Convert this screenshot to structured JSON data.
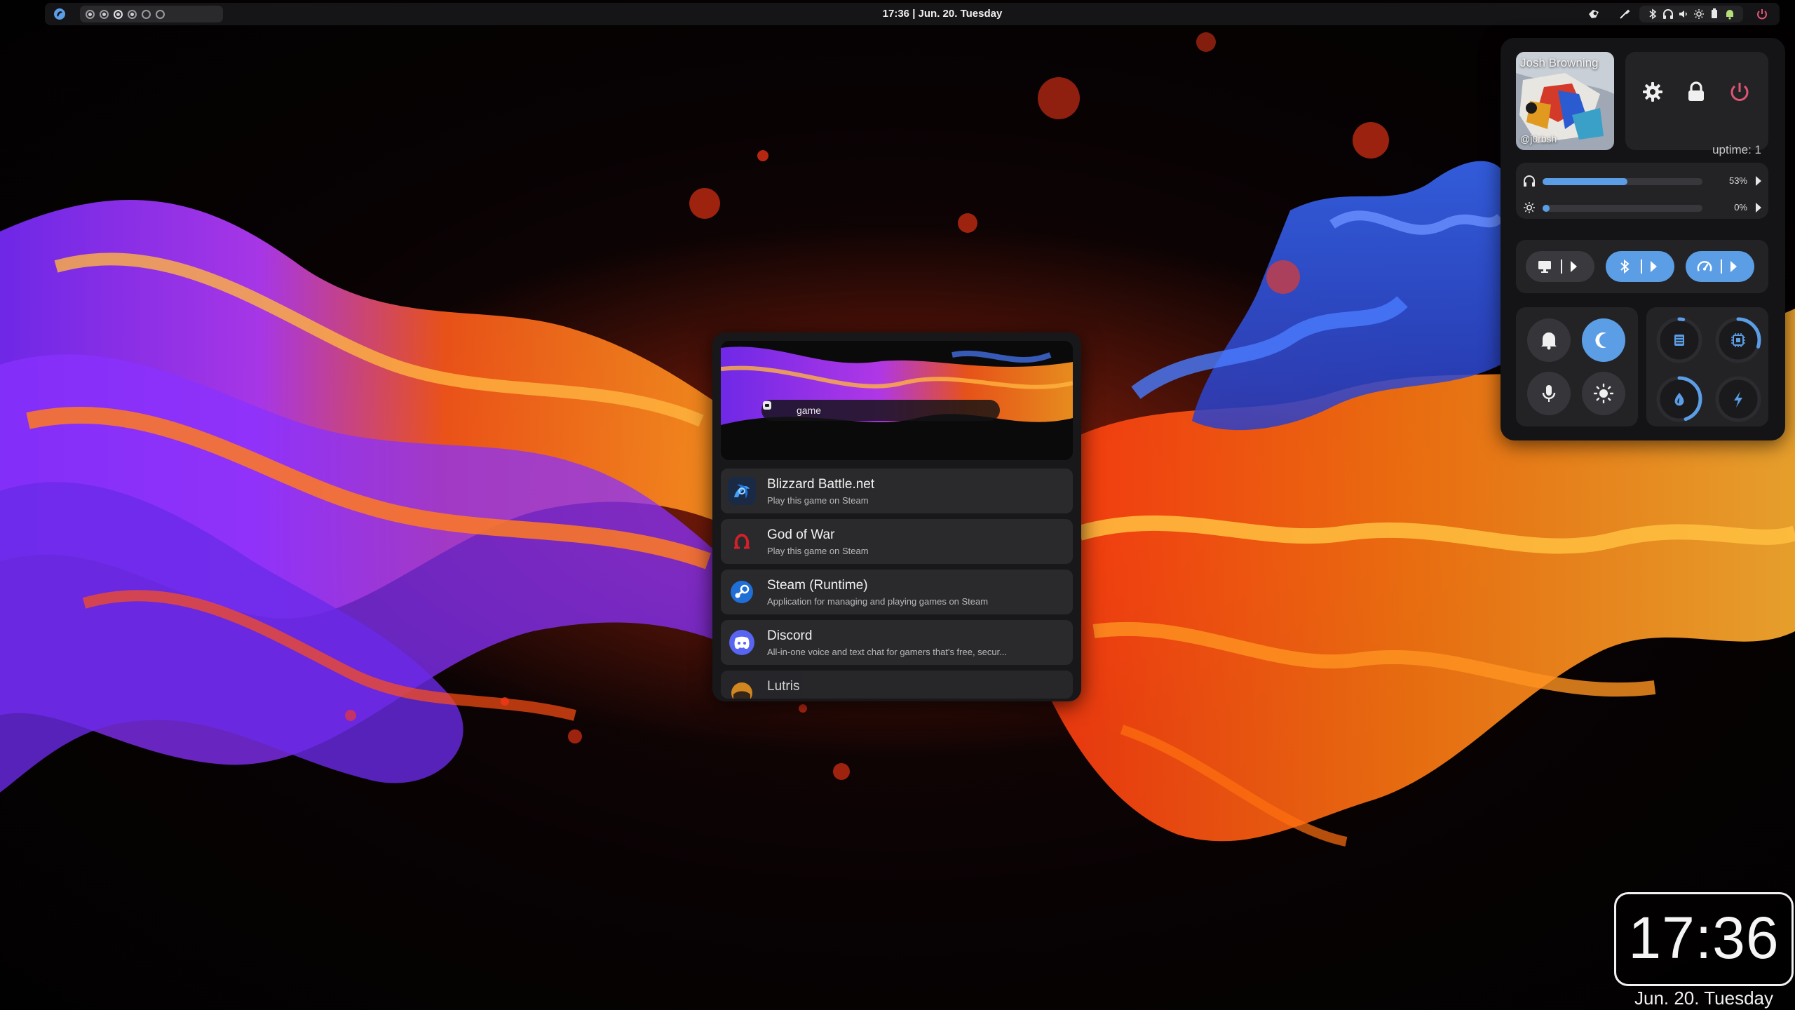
{
  "topbar": {
    "clock_text": "17:36  |  Jun. 20. Tuesday",
    "workspaces": [
      {
        "state": "filled"
      },
      {
        "state": "filled"
      },
      {
        "state": "active"
      },
      {
        "state": "filled"
      },
      {
        "state": "empty"
      },
      {
        "state": "empty"
      }
    ],
    "icons": [
      "logo-icon",
      "steam-tray-icon",
      "color-picker-icon",
      "bluetooth-icon",
      "headphones-icon",
      "volume-icon",
      "brightness-icon",
      "battery-icon",
      "notification-icon",
      "power-icon"
    ]
  },
  "launcher": {
    "search_query": "game",
    "results": [
      {
        "title": "Blizzard Battle.net",
        "description": "Play this game on Steam",
        "icon": "battlenet-icon"
      },
      {
        "title": "God of War",
        "description": "Play this game on Steam",
        "icon": "god-of-war-icon"
      },
      {
        "title": "Steam (Runtime)",
        "description": "Application for managing and playing games on Steam",
        "icon": "steam-icon"
      },
      {
        "title": "Discord",
        "description": "All-in-one voice and text chat for gamers that's free, secur...",
        "icon": "discord-icon"
      },
      {
        "title": "Lutris",
        "description": "",
        "icon": "lutris-icon"
      }
    ]
  },
  "quick_settings": {
    "user_name": "Josh Browning",
    "user_handle": "@j0rbsh",
    "uptime": "uptime: 1",
    "volume": {
      "label": "53%",
      "fraction": 0.53
    },
    "brightness": {
      "label": "0%",
      "fraction": 0.0
    },
    "toggles": [
      {
        "icon": "monitor-icon",
        "active": false
      },
      {
        "icon": "bluetooth-icon",
        "active": true
      },
      {
        "icon": "speedometer-icon",
        "active": true
      }
    ],
    "buttons": [
      {
        "icon": "bell-icon",
        "active": false
      },
      {
        "icon": "moon-icon",
        "active": true
      },
      {
        "icon": "microphone-icon",
        "active": false
      },
      {
        "icon": "sun-icon",
        "active": false
      }
    ],
    "gauges": [
      {
        "icon": "memory-icon",
        "fraction": 0.03
      },
      {
        "icon": "cpu-icon",
        "fraction": 0.3
      },
      {
        "icon": "temperature-icon",
        "fraction": 0.45
      },
      {
        "icon": "power-draw-icon",
        "fraction": 0.0
      }
    ],
    "accent": "#5b9ee6",
    "power_color": "#e05575"
  },
  "desktop_clock": {
    "time": "17:36",
    "date": "Jun. 20. Tuesday"
  }
}
